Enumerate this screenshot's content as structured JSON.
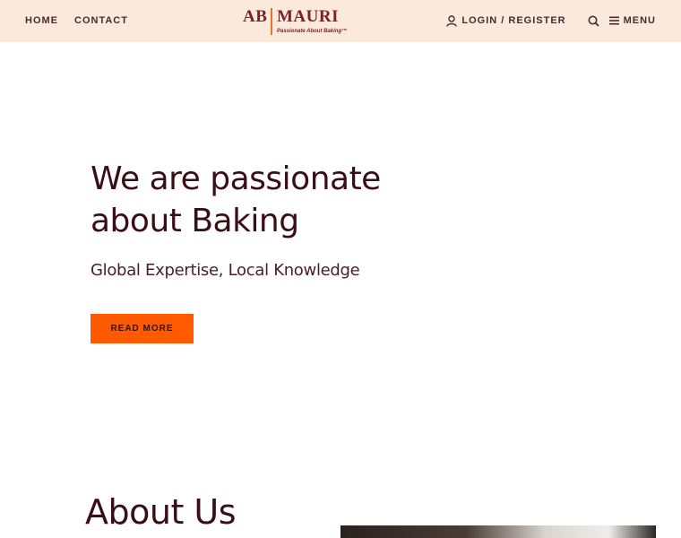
{
  "nav": {
    "left_links": [
      "HOME",
      "CONTACT"
    ],
    "login_label": "LOGIN / REGISTER",
    "menu_label": "MENU",
    "icons": {
      "user": "user-icon",
      "search": "search-icon",
      "menu": "hamburger-icon"
    }
  },
  "logo": {
    "ab": "AB",
    "mauri": "MAURI",
    "tagline": "Passionate About Baking™"
  },
  "hero": {
    "title": "We are passionate about Baking",
    "subtitle": "Global Expertise, Local Knowledge",
    "cta_label": "READ MORE"
  },
  "about": {
    "title": "About Us"
  },
  "colors": {
    "topbar": "#fbe9dc",
    "brand": "#7b1f2b",
    "accent": "#ff5a00",
    "heading": "#3a0e16"
  }
}
